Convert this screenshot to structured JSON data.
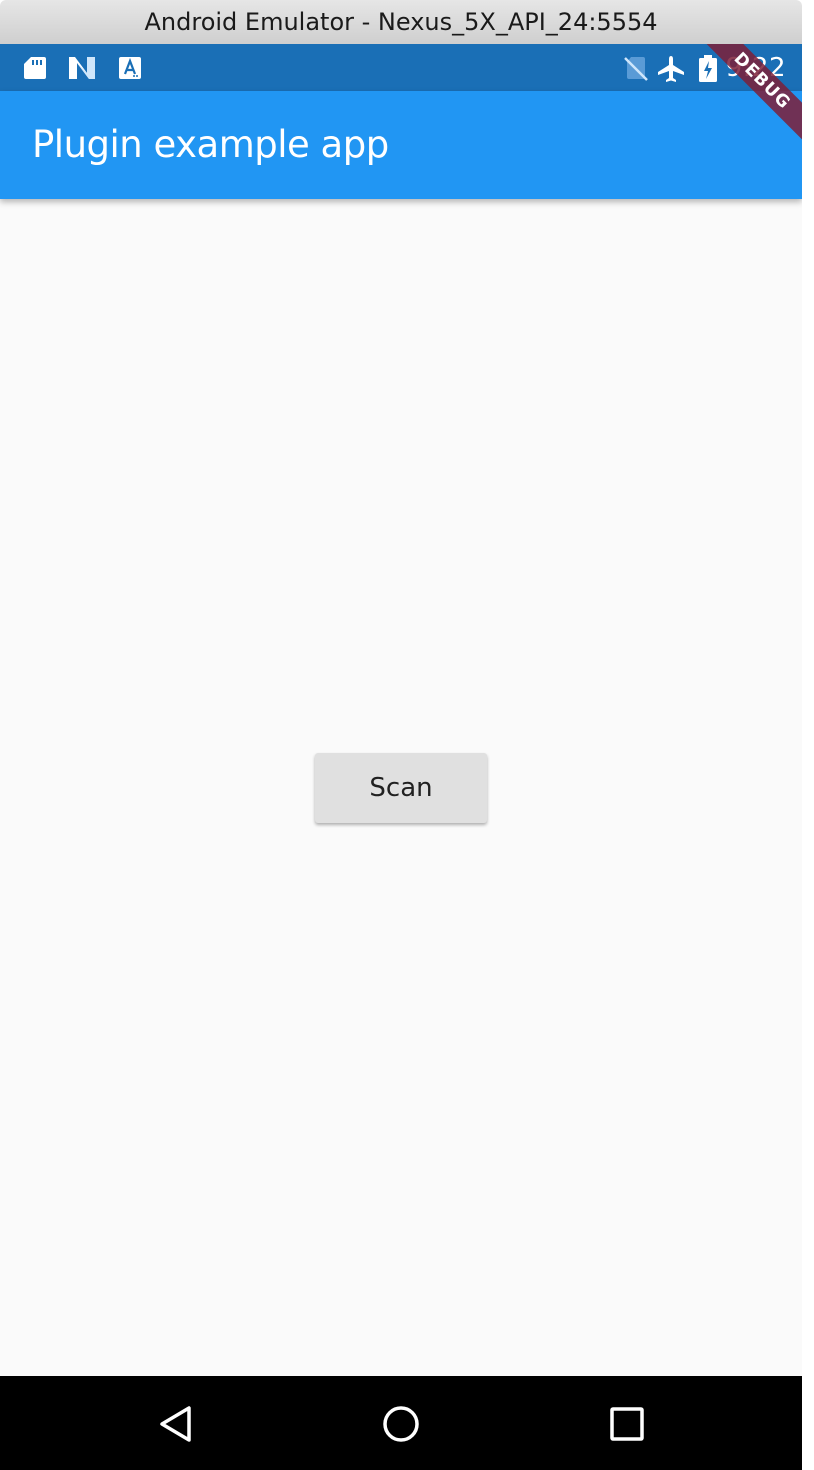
{
  "window": {
    "title": "Android Emulator - Nexus_5X_API_24:5554"
  },
  "status_bar": {
    "time": "9:22",
    "left_icons": [
      "sd-card-icon",
      "android-n-icon",
      "text-app-icon"
    ],
    "right_icons": [
      "no-sim-icon",
      "airplane-mode-icon",
      "battery-charging-icon"
    ]
  },
  "app_bar": {
    "title": "Plugin example app"
  },
  "main": {
    "scan_label": "Scan"
  },
  "debug_banner": {
    "label": "DEBUG"
  },
  "navigation_bar": {
    "buttons": [
      "back-icon",
      "home-icon",
      "recents-icon"
    ]
  },
  "colors": {
    "status_bar": "#1a6fb6",
    "app_bar": "#2196f3",
    "background": "#fafafa",
    "button": "#e0e0e0",
    "debug_ribbon": "#7e2038",
    "nav_bar": "#000000"
  }
}
